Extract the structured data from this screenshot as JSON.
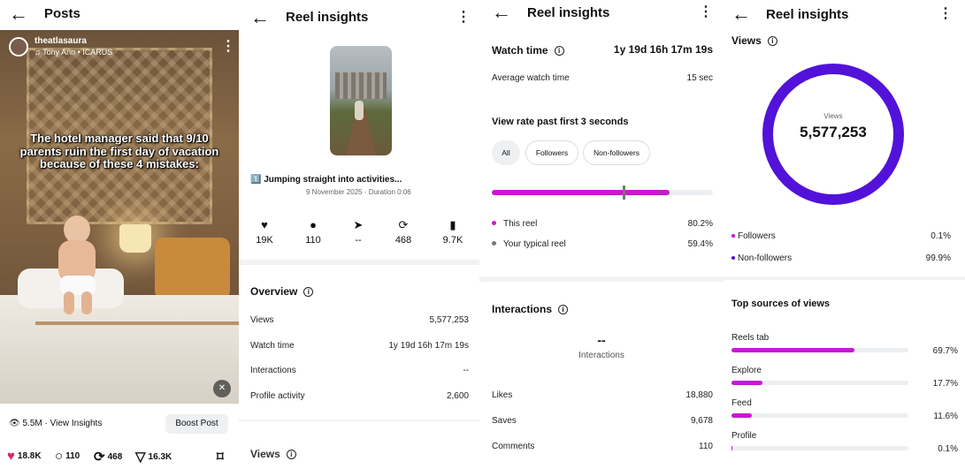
{
  "posts": {
    "title": "Posts",
    "username": "theatlasaura",
    "song": "Tony Ann • ICARUS",
    "caption": "The hotel manager said that 9/10 parents ruin the first day of vacation because of these 4 mistakes:",
    "view_insights": "5.5M · View Insights",
    "boost": "Boost Post",
    "actions": {
      "likes": "18.8K",
      "comments": "110",
      "reposts": "468",
      "shares": "16.3K"
    }
  },
  "insights_overview": {
    "title": "Reel insights",
    "caption": "1️⃣ Jumping straight into activities...",
    "date": "9 November 2025 · Duration 0:06",
    "stats": {
      "likes": "19K",
      "comments": "110",
      "shares": "--",
      "reposts": "468",
      "saves": "9.7K"
    },
    "overview_title": "Overview",
    "rows": [
      {
        "label": "Views",
        "value": "5,577,253"
      },
      {
        "label": "Watch time",
        "value": "1y 19d 16h 17m 19s"
      },
      {
        "label": "Interactions",
        "value": "--"
      },
      {
        "label": "Profile activity",
        "value": "2,600"
      }
    ],
    "views_title": "Views"
  },
  "insights_watch": {
    "title": "Reel insights",
    "watch_time_label": "Watch time",
    "watch_time_value": "1y 19d 16h 17m 19s",
    "avg_label": "Average watch time",
    "avg_value": "15 sec",
    "view_rate_title": "View rate past first 3 seconds",
    "chips": [
      "All",
      "Followers",
      "Non-followers"
    ],
    "this_reel_label": "This reel",
    "this_reel_value": "80.2%",
    "this_reel_pct": 80.2,
    "typical_label": "Your typical reel",
    "typical_value": "59.4%",
    "typical_pct": 59.4,
    "interactions_title": "Interactions",
    "interactions_value": "--",
    "interactions_sub": "Interactions",
    "rows": [
      {
        "label": "Likes",
        "value": "18,880"
      },
      {
        "label": "Saves",
        "value": "9,678"
      },
      {
        "label": "Comments",
        "value": "110"
      }
    ]
  },
  "insights_views": {
    "title": "Reel insights",
    "views_title": "Views",
    "ring_label": "Views",
    "ring_value": "5,577,253",
    "followers_label": "Followers",
    "followers_value": "0.1%",
    "nonfollowers_label": "Non-followers",
    "nonfollowers_value": "99.9%",
    "sources_title": "Top sources of views",
    "sources": [
      {
        "label": "Reels tab",
        "value": "69.7%",
        "pct": 69.7
      },
      {
        "label": "Explore",
        "value": "17.7%",
        "pct": 17.7
      },
      {
        "label": "Feed",
        "value": "11.6%",
        "pct": 11.6
      },
      {
        "label": "Profile",
        "value": "0.1%",
        "pct": 0.1
      }
    ]
  },
  "colors": {
    "accent_magenta": "#c61ad1",
    "accent_purple": "#5212d9",
    "like_red": "#e0245e"
  }
}
